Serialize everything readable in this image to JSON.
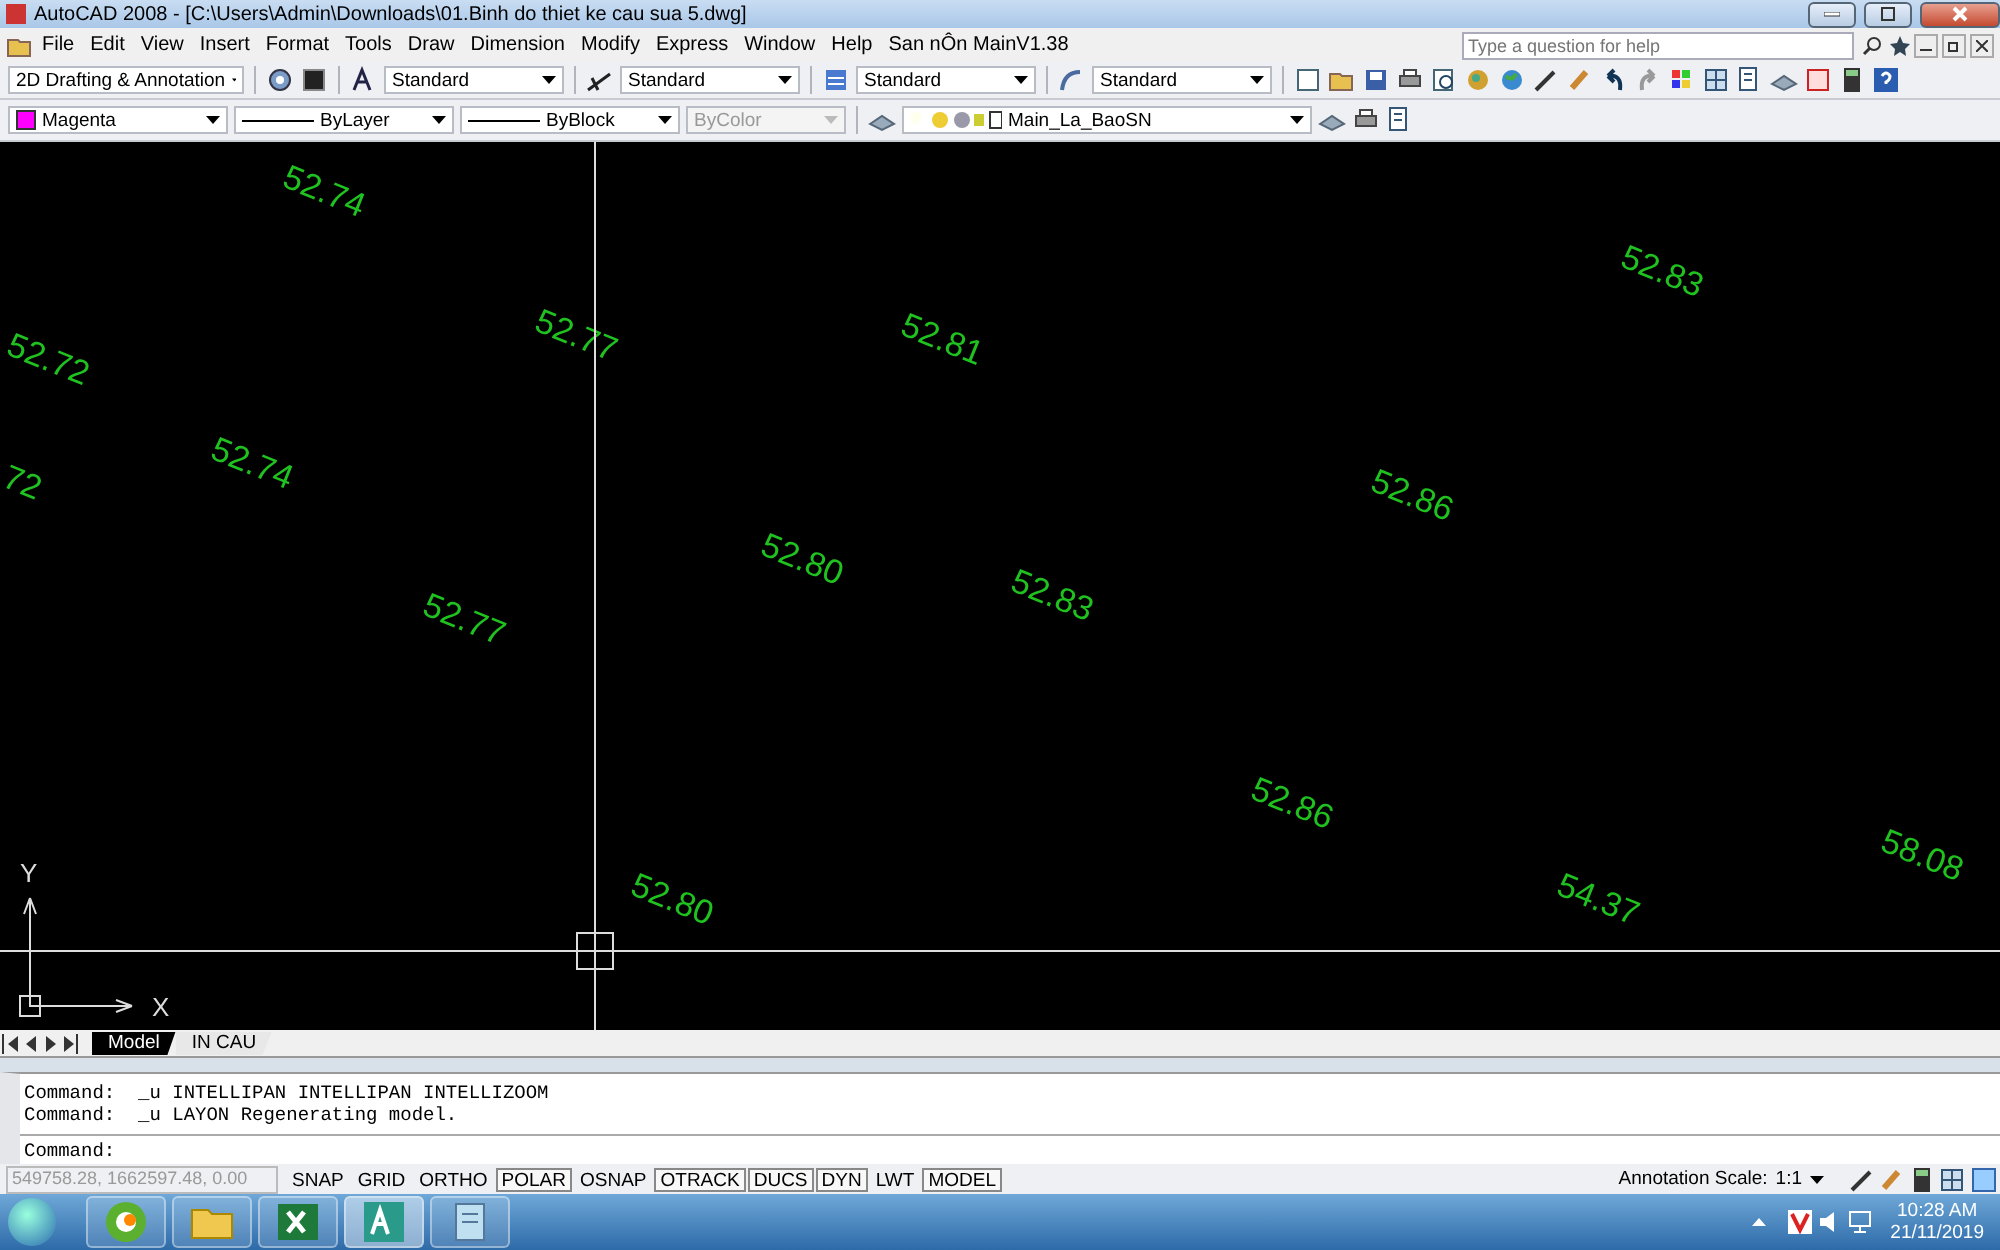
{
  "window": {
    "title": "AutoCAD 2008 - [C:\\Users\\Admin\\Downloads\\01.Binh do thiet ke cau sua 5.dwg]"
  },
  "menu": [
    "File",
    "Edit",
    "View",
    "Insert",
    "Format",
    "Tools",
    "Draw",
    "Dimension",
    "Modify",
    "Express",
    "Window",
    "Help",
    "San nÔn MainV1.38"
  ],
  "help_search": {
    "placeholder": "Type a question for help"
  },
  "toolbar_1": [
    {
      "value": "2D Drafting & Annotation"
    },
    {
      "value": "Standard"
    },
    {
      "value": "Standard"
    },
    {
      "value": "Standard"
    },
    {
      "value": "Standard"
    }
  ],
  "toolbar_2": [
    {
      "kind": "color",
      "value": "Magenta",
      "color": "#ff00ff",
      "disabled": false
    },
    {
      "kind": "line",
      "value": "ByLayer",
      "disabled": false
    },
    {
      "kind": "line",
      "value": "ByBlock",
      "disabled": false
    },
    {
      "kind": "plain",
      "value": "ByColor",
      "disabled": true
    },
    {
      "kind": "layer",
      "value": "Main_La_BaoSN",
      "disabled": false
    }
  ],
  "drawing": {
    "elevations": [
      "52.72",
      "52.74",
      "52.77",
      "52.81",
      "52.83",
      "72",
      "52.74",
      "52.80",
      "52.83",
      "52.86",
      "52.77",
      "52.86",
      "58.08",
      "54.37",
      "52.80"
    ],
    "axis_x": "X",
    "axis_y": "Y"
  },
  "layout_tabs": [
    {
      "label": "Model",
      "selected": true
    },
    {
      "label": "IN CAU",
      "selected": false
    }
  ],
  "command_history": [
    "Command:  _u INTELLIPAN INTELLIPAN INTELLIZOOM",
    "Command:  _u LAYON Regenerating model."
  ],
  "command_prompt": "Command:",
  "status_bar": {
    "coordinates": "549758.28, 1662597.48, 0.00",
    "toggles": [
      {
        "label": "SNAP",
        "on": false
      },
      {
        "label": "GRID",
        "on": false
      },
      {
        "label": "ORTHO",
        "on": false
      },
      {
        "label": "POLAR",
        "on": true
      },
      {
        "label": "OSNAP",
        "on": false
      },
      {
        "label": "OTRACK",
        "on": true
      },
      {
        "label": "DUCS",
        "on": true
      },
      {
        "label": "DYN",
        "on": true
      },
      {
        "label": "LWT",
        "on": false
      },
      {
        "label": "MODEL",
        "on": true
      }
    ],
    "annotation_scale_label": "Annotation Scale:",
    "annotation_scale": "1:1"
  },
  "taskbar": {
    "time": "10:28 AM",
    "date": "21/11/2019",
    "apps": [
      {
        "kind": "browser",
        "selected": false
      },
      {
        "kind": "folder",
        "selected": false
      },
      {
        "kind": "excel",
        "selected": false
      },
      {
        "kind": "autocad",
        "selected": true
      },
      {
        "kind": "notepad",
        "selected": false
      }
    ]
  }
}
